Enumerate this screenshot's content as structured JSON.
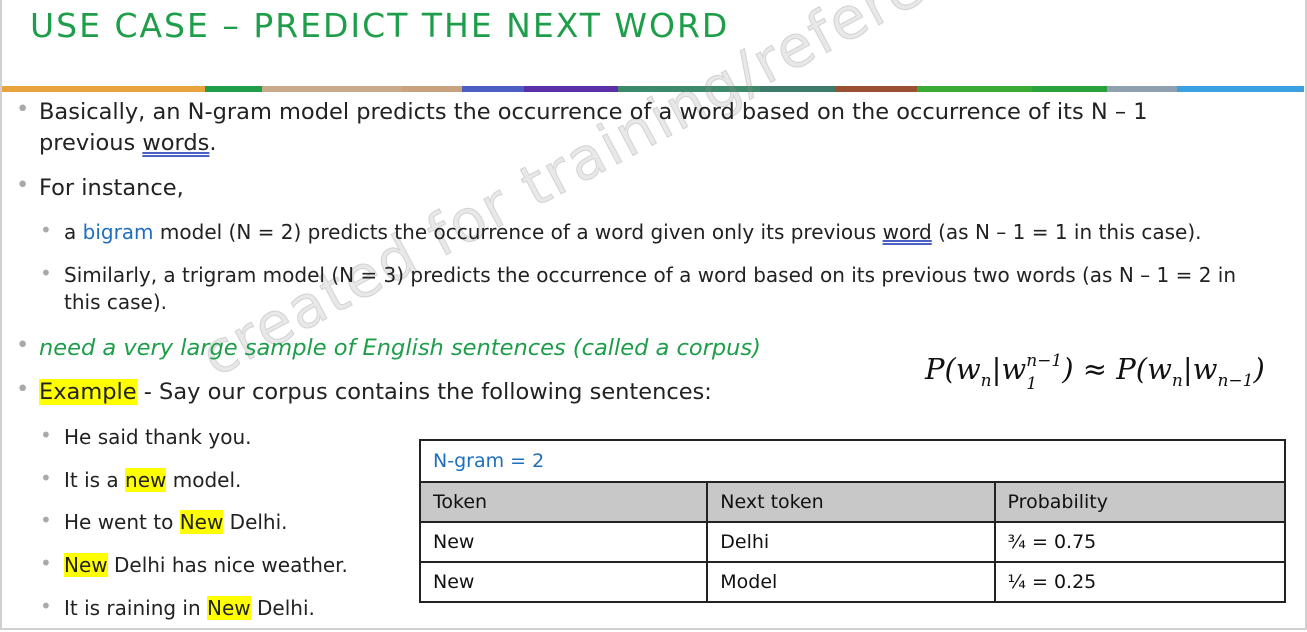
{
  "title": "USE CASE – PREDICT THE NEXT WORD",
  "rule_colors": [
    "#e8a33d",
    "#1e9e4a",
    "#c8a98a",
    "#c7a27c",
    "#4a5fc1",
    "#5b2fa8",
    "#3d8a6b",
    "#3d7a6b",
    "#9a5030",
    "#3aaa35",
    "#2aa13a",
    "#8fa0b0",
    "#3aa0e0"
  ],
  "bullets": {
    "b1_part1": "Basically, an N-gram model predicts the occurrence of a word based on the occurrence of its N – 1",
    "b1_part2": "previous ",
    "b1_underlined": "words",
    "b1_end": ".",
    "b2": "For instance,",
    "b2a_pre": "a ",
    "b2a_blue": "bigram",
    "b2a_mid": " model (N = 2) predicts the occurrence of a word given only its previous ",
    "b2a_underlined": "word",
    "b2a_end": " (as N – 1 = 1 in this case).",
    "b2b_line1": "Similarly, a trigram model (N = 3) predicts the occurrence of a word based on its previous two words (as N – 1 = 2 in",
    "b2b_line2": "this case).",
    "b3": "need a very large sample of English sentences (called a corpus)",
    "b4_highlight": "Example",
    "b4_rest": " - Say our corpus contains the following sentences:"
  },
  "sentences": [
    {
      "pre": "He said thank you.",
      "hl": "",
      "post": ""
    },
    {
      "pre": "It is a ",
      "hl": "new",
      "post": " model."
    },
    {
      "pre": "He went to ",
      "hl": "New",
      "post": " Delhi."
    },
    {
      "pre": "",
      "hl": "New",
      "post": " Delhi has nice weather."
    },
    {
      "pre": "It is raining in ",
      "hl": "New",
      "post": " Delhi."
    }
  ],
  "formula": {
    "p1": "P(w",
    "sub1": "n",
    "bar": "|w",
    "sup2": "n−1",
    "sub2": "1",
    "p2": ") ≈ P(w",
    "sub3": "n",
    "bar2": "|w",
    "sub4": "n−1",
    "p3": ")"
  },
  "table": {
    "caption": "N-gram = 2",
    "headers": [
      "Token",
      "Next token",
      "Probability"
    ],
    "rows": [
      [
        "New",
        "Delhi",
        "¾ = 0.75"
      ],
      [
        "New",
        "Model",
        "¼ = 0.25"
      ]
    ]
  },
  "watermark": "created for training/reference purposes"
}
